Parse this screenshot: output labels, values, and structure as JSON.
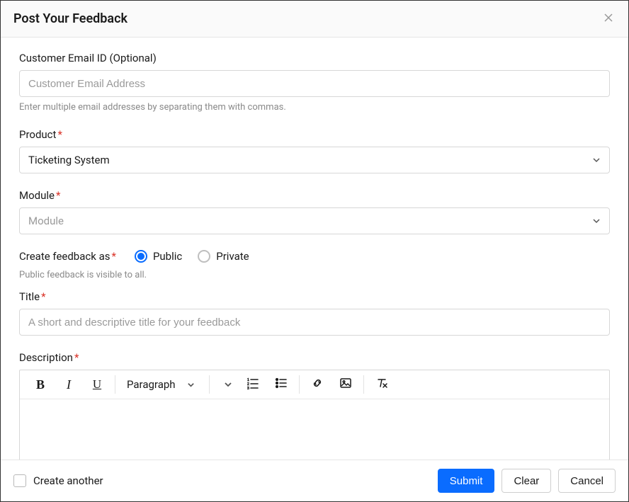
{
  "modal": {
    "title": "Post Your Feedback"
  },
  "email": {
    "label": "Customer Email ID (Optional)",
    "placeholder": "Customer Email Address",
    "hint": "Enter multiple email addresses by separating them with commas."
  },
  "product": {
    "label": "Product",
    "value": "Ticketing System"
  },
  "module": {
    "label": "Module",
    "placeholder": "Module"
  },
  "visibility": {
    "label": "Create feedback as",
    "option_public": "Public",
    "option_private": "Private",
    "selected": "public",
    "hint": "Public feedback is visible to all."
  },
  "title_field": {
    "label": "Title",
    "placeholder": "A short and descriptive title for your feedback"
  },
  "description": {
    "label": "Description",
    "toolbar": {
      "style_dropdown": "Paragraph"
    }
  },
  "footer": {
    "create_another": "Create another",
    "submit": "Submit",
    "clear": "Clear",
    "cancel": "Cancel"
  }
}
